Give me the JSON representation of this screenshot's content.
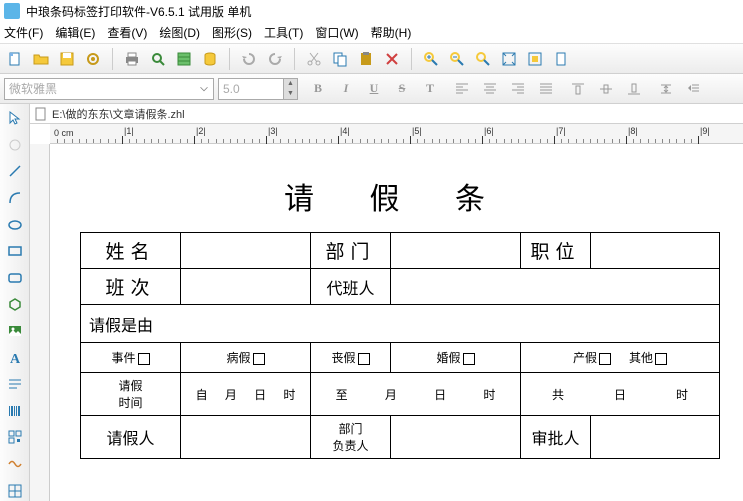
{
  "app": {
    "title": "中琅条码标签打印软件-V6.5.1 试用版 单机"
  },
  "menu": {
    "file": "文件(F)",
    "edit": "编辑(E)",
    "view": "查看(V)",
    "draw": "绘图(D)",
    "shape": "图形(S)",
    "tool": "工具(T)",
    "window": "窗口(W)",
    "help": "帮助(H)"
  },
  "font": {
    "name": "微软雅黑",
    "size": "5.0"
  },
  "fmt": {
    "B": "B",
    "I": "I",
    "U": "U",
    "S": "S",
    "T": "T"
  },
  "doc": {
    "path": "E:\\做的东东\\文章请假条.zhl"
  },
  "ruler": {
    "unit": "0 cm",
    "marks": [
      "|1|",
      "|2|",
      "|3|",
      "|4|",
      "|5|",
      "|6|",
      "|7|",
      "|8|",
      "|9|"
    ]
  },
  "form": {
    "title": "请 假 条",
    "name_lbl": "姓名",
    "dept_lbl": "部门",
    "pos_lbl": "职位",
    "shift_lbl": "班次",
    "sub_lbl": "代班人",
    "reason_lbl": "请假是由",
    "type_event": "事件",
    "type_sick": "病假",
    "type_funeral": "丧假",
    "type_marry": "婚假",
    "type_birth": "产假",
    "type_other": "其他",
    "time_lbl1": "请假",
    "time_lbl2": "时间",
    "from": "自",
    "month": "月",
    "day": "日",
    "hour": "时",
    "to": "至",
    "total": "共",
    "applicant": "请假人",
    "dept_head1": "部门",
    "dept_head2": "负责人",
    "approver": "审批人"
  }
}
